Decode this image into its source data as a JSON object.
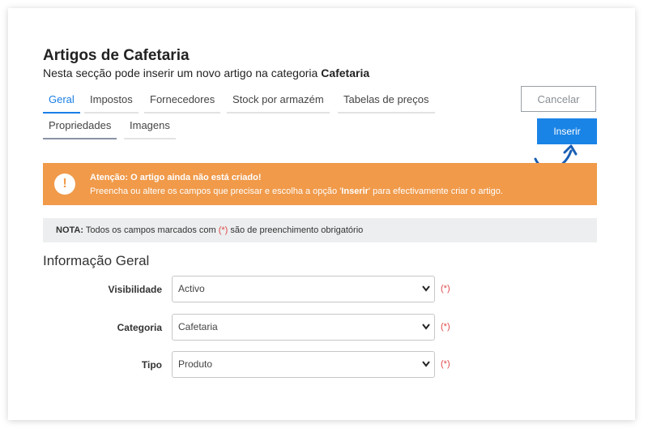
{
  "header": {
    "title": "Artigos de Cafetaria",
    "subtitle_prefix": "Nesta secção pode inserir um novo artigo na categoria ",
    "subtitle_category": "Cafetaria"
  },
  "tabs": [
    {
      "label": "Geral",
      "active": true
    },
    {
      "label": "Impostos"
    },
    {
      "label": "Fornecedores"
    },
    {
      "label": "Stock por armazém"
    },
    {
      "label": "Tabelas de preços"
    },
    {
      "label": "Propriedades"
    },
    {
      "label": "Imagens"
    }
  ],
  "actions": {
    "cancel_label": "Cancelar",
    "insert_label": "Inserir"
  },
  "alert": {
    "icon_glyph": "!",
    "title": "Atenção: O artigo ainda não está criado!",
    "text_prefix": "Preencha ou altere os campos que precisar e escolha a opção '",
    "text_option": "Inserir",
    "text_suffix": "' para efectivamente criar o artigo."
  },
  "note": {
    "label": "NOTA:",
    "text_prefix": " Todos os campos marcados com ",
    "required_marker": "(*)",
    "text_suffix": " são de preenchimento obrigatório"
  },
  "section": {
    "title": "Informação Geral"
  },
  "fields": [
    {
      "label": "Visibilidade",
      "value": "Activo",
      "required": "(*)"
    },
    {
      "label": "Categoria",
      "value": "Cafetaria",
      "required": "(*)"
    },
    {
      "label": "Tipo",
      "value": "Produto",
      "required": "(*)"
    }
  ],
  "colors": {
    "accent": "#1a84e6",
    "alert": "#f09a4a",
    "required": "#e04848"
  }
}
